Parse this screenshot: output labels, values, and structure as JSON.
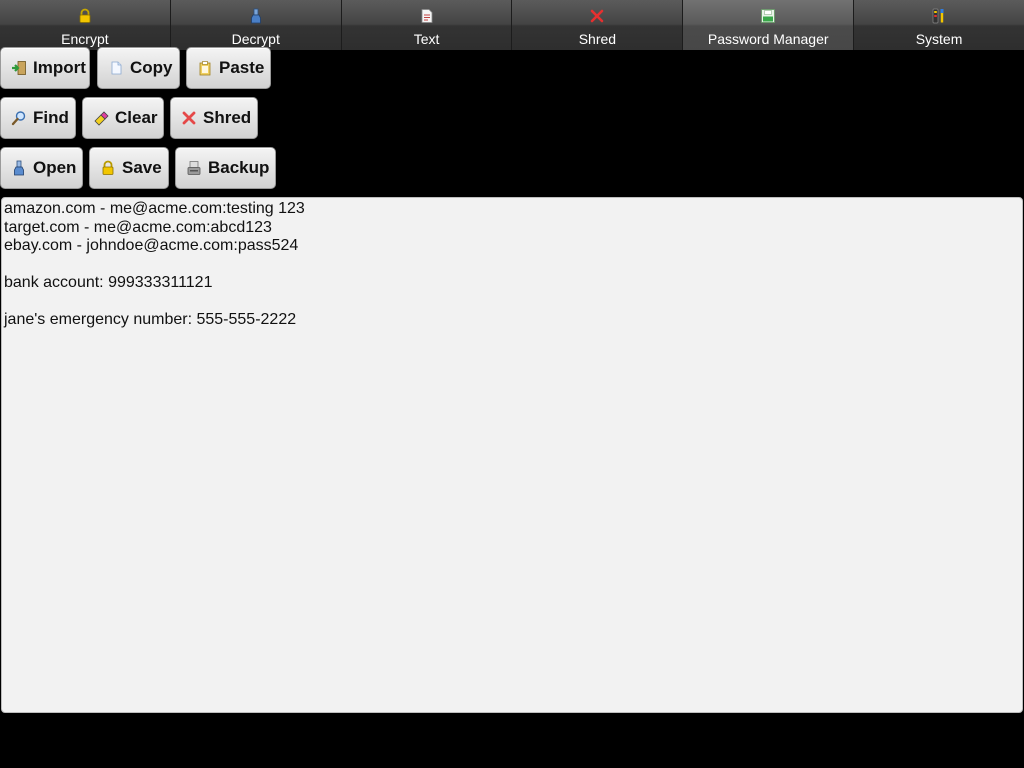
{
  "tabs": [
    {
      "label": "Encrypt",
      "icon": "lock-icon",
      "active": false
    },
    {
      "label": "Decrypt",
      "icon": "bottle-icon",
      "active": false
    },
    {
      "label": "Text",
      "icon": "document-icon",
      "active": false
    },
    {
      "label": "Shred",
      "icon": "x-icon",
      "active": false
    },
    {
      "label": "Password Manager",
      "icon": "save-disk-icon",
      "active": true
    },
    {
      "label": "System",
      "icon": "tools-icon",
      "active": false
    }
  ],
  "toolbar": {
    "import_label": "Import",
    "copy_label": "Copy",
    "paste_label": "Paste",
    "find_label": "Find",
    "clear_label": "Clear",
    "shred_label": "Shred",
    "open_label": "Open",
    "save_label": "Save",
    "backup_label": "Backup"
  },
  "editor": {
    "lines": [
      "amazon.com - me@acme.com:testing 123",
      "target.com - me@acme.com:abcd123",
      "ebay.com - johndoe@acme.com:pass524",
      "",
      "bank account: 999333311121",
      "",
      "jane's emergency number: 555-555-2222"
    ]
  },
  "colors": {
    "tab_bg": "#444444",
    "tab_active_bg": "#5a5a5a",
    "button_bg": "#e3e3e3",
    "editor_bg": "#f2f2f2",
    "background": "#000000"
  }
}
